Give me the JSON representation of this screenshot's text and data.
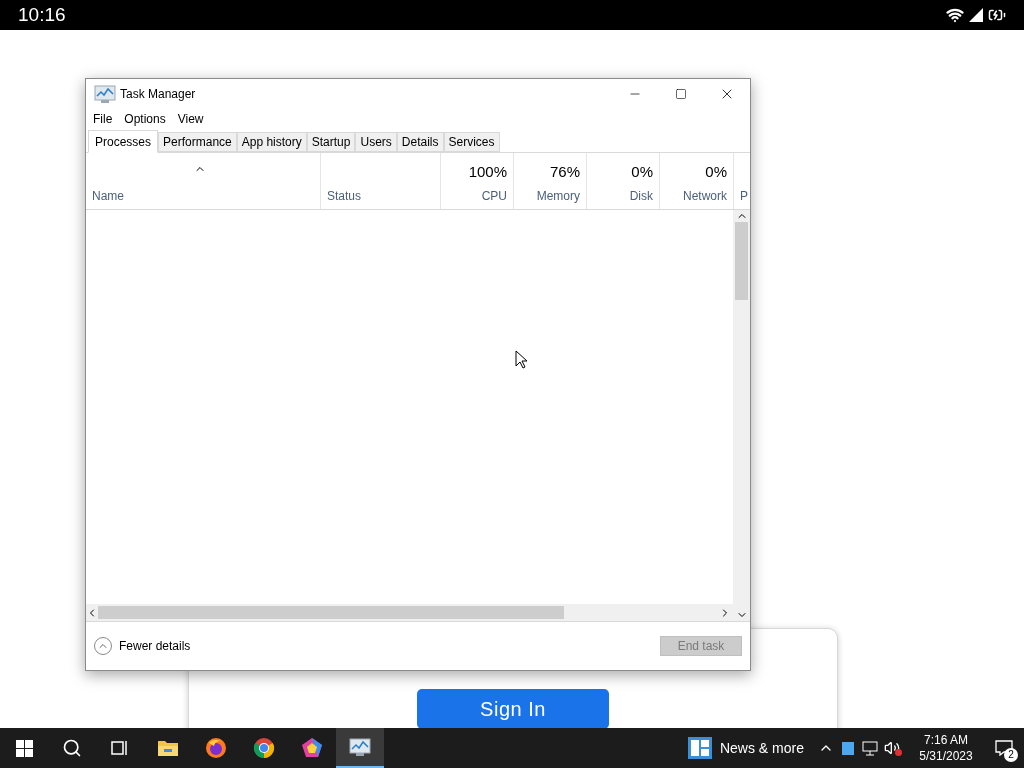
{
  "status_bar": {
    "time": "10:16"
  },
  "background_card": {
    "button": "Sign In"
  },
  "window": {
    "title": "Task Manager",
    "menu": [
      "File",
      "Options",
      "View"
    ],
    "tabs": [
      {
        "label": "Processes",
        "selected": true
      },
      {
        "label": "Performance",
        "selected": false
      },
      {
        "label": "App history",
        "selected": false
      },
      {
        "label": "Startup",
        "selected": false
      },
      {
        "label": "Users",
        "selected": false
      },
      {
        "label": "Details",
        "selected": false
      },
      {
        "label": "Services",
        "selected": false
      }
    ],
    "columns": [
      {
        "label": "Name",
        "sorted": true
      },
      {
        "label": "Status",
        "sorted": false
      },
      {
        "label": "CPU",
        "usage": "100%",
        "sorted": false
      },
      {
        "label": "Memory",
        "usage": "76%",
        "sorted": false
      },
      {
        "label": "Disk",
        "usage": "0%",
        "sorted": false
      },
      {
        "label": "Network",
        "usage": "0%",
        "sorted": false
      },
      {
        "label": "P",
        "sorted": false
      }
    ],
    "footer": {
      "toggle": "Fewer details",
      "button": {
        "label": "End task",
        "disabled": true
      }
    }
  },
  "taskbar": {
    "apps": [
      {
        "kind": "search",
        "selected": false
      },
      {
        "kind": "taskview",
        "selected": false
      },
      {
        "kind": "folder",
        "selected": false
      },
      {
        "kind": "firefox",
        "selected": false
      },
      {
        "kind": "chrome",
        "selected": false
      },
      {
        "kind": "pentagon",
        "selected": false
      },
      {
        "kind": "monitor",
        "selected": true
      }
    ],
    "news": "News & more",
    "time": "7:16 AM",
    "date": "5/31/2023",
    "notifications": "2"
  }
}
